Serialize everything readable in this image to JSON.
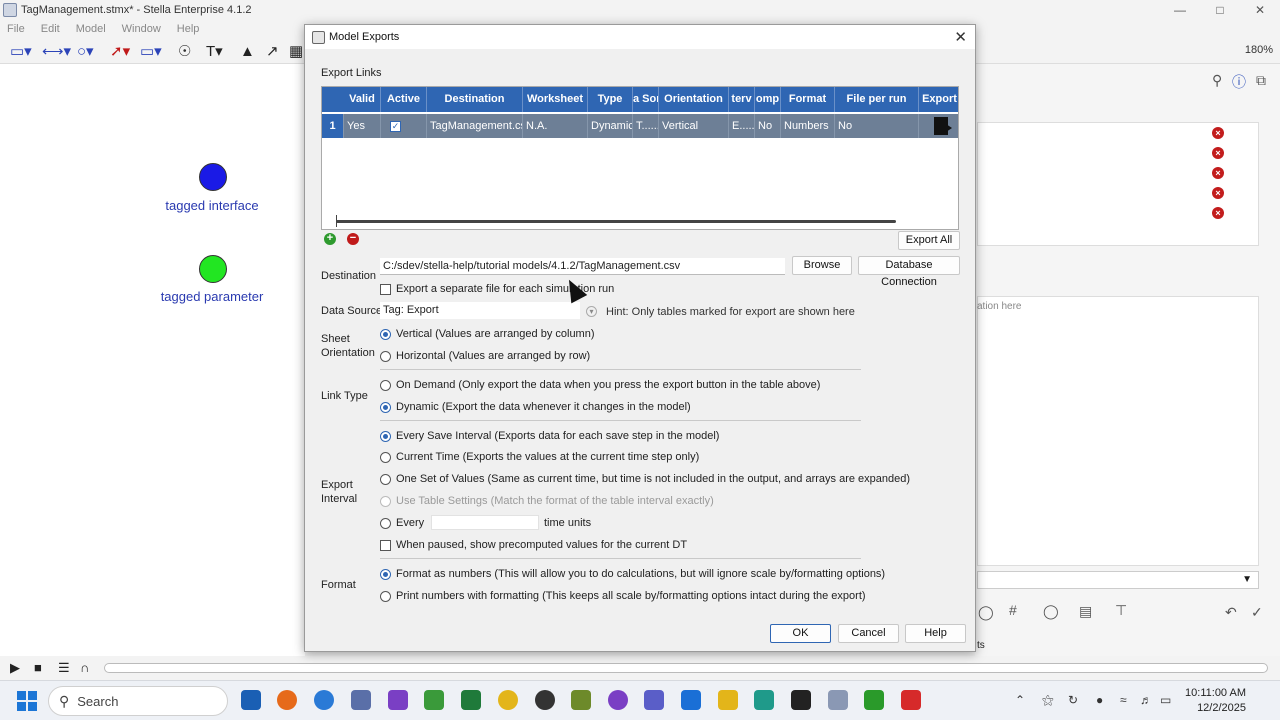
{
  "app": {
    "title": "TagManagement.stmx* - Stella Enterprise 4.1.2",
    "menu": [
      "File",
      "Edit",
      "Model",
      "Window",
      "Help"
    ],
    "zoom": "180%"
  },
  "canvas": {
    "nodes": [
      {
        "label": "tagged interface",
        "color": "#1a1ae6"
      },
      {
        "label": "tagged parameter",
        "color": "#22e622"
      }
    ]
  },
  "right_panel": {
    "hint_text": "ation here",
    "partial_label": "ts"
  },
  "dialog": {
    "title": "Model Exports",
    "export_links_label": "Export Links",
    "table": {
      "columns": [
        "Valid",
        "Active",
        "Destination",
        "Worksheet",
        "Type",
        "a Sor",
        "Orientation",
        "terv",
        "omp",
        "Format",
        "File per run",
        "Export"
      ],
      "rows": [
        {
          "num": "1",
          "valid": "Yes",
          "active": "✓",
          "destination": "TagManagement.csv",
          "worksheet": "N.A.",
          "type": "Dynamic",
          "source": "T......",
          "orientation": "Vertical",
          "interval": "E......",
          "comp": "No",
          "format": "Numbers",
          "file_per_run": "No"
        }
      ]
    },
    "export_all_label": "Export All",
    "destination_label": "Destination",
    "destination_value": "C:/sdev/stella-help/tutorial models/4.1.2/TagManagement.csv",
    "browse_label": "Browse",
    "db_connection_label": "Database Connection",
    "separate_file_label": "Export a separate file for each simulation run",
    "data_source_label": "Data Source",
    "data_source_value": "Tag: Export",
    "data_source_hint": "Hint: Only tables marked for export are shown here",
    "sheet_orientation_label": "Sheet\nOrientation",
    "orientation_vertical": "Vertical (Values are arranged by column)",
    "orientation_horizontal": "Horizontal (Values are arranged by row)",
    "link_type_label": "Link Type",
    "link_on_demand": "On Demand (Only export the data when you press the export button in the table above)",
    "link_dynamic": "Dynamic (Export the data whenever it changes in the model)",
    "export_interval_label": "Export\nInterval",
    "interval_every_save": "Every Save Interval (Exports data for each save step in the model)",
    "interval_current_time": "Current Time (Exports the values at the current time step only)",
    "interval_one_set": "One Set of Values (Same as current time, but time is not included in the output, and arrays are expanded)",
    "interval_table_settings": "Use Table Settings (Match the format of the table interval exactly)",
    "interval_every": "Every",
    "interval_time_units": "time units",
    "paused_precomputed": "When paused, show precomputed values for the current DT",
    "format_label": "Format",
    "format_numbers": "Format as numbers (This will allow you to do calculations, but will ignore scale by/formatting options)",
    "format_print": "Print numbers with formatting (This keeps all scale by/formatting options intact during the export)",
    "ok_label": "OK",
    "cancel_label": "Cancel",
    "help_label": "Help"
  },
  "taskbar": {
    "search_label": "Search",
    "time": "10:11:00 AM",
    "date": "12/2/2025"
  },
  "colors": {
    "accent": "#2f66b3",
    "grid_row": "#6d7f96"
  }
}
